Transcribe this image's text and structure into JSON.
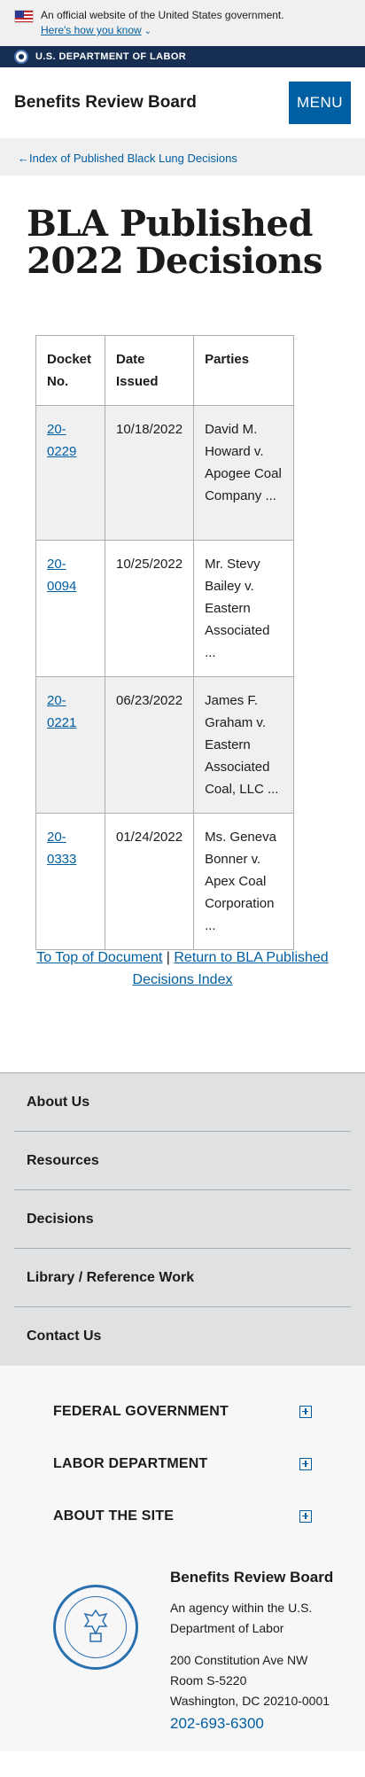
{
  "gov_banner": {
    "text": "An official website of the United States government.",
    "link": "Here's how you know"
  },
  "dol_bar": {
    "label": "U.S. DEPARTMENT OF LABOR"
  },
  "header": {
    "title": "Benefits Review Board",
    "menu_label": "MENU"
  },
  "breadcrumb": {
    "link": "Index of Published Black Lung Decisions"
  },
  "page": {
    "title": "BLA Published 2022 Decisions"
  },
  "table": {
    "headers": [
      "Docket No.",
      "Date Issued",
      "Parties"
    ],
    "rows": [
      {
        "docket": "20-0229",
        "date": "10/18/2022",
        "parties": "David M. Howard v. Apogee Coal Company ..."
      },
      {
        "docket": "20-0094",
        "date": "10/25/2022",
        "parties": "Mr. Stevy Bailey v. Eastern Associated ..."
      },
      {
        "docket": "20-0221",
        "date": "06/23/2022",
        "parties": "James F. Graham v. Eastern Associated Coal, LLC ..."
      },
      {
        "docket": "20-0333",
        "date": "01/24/2022",
        "parties": "Ms. Geneva Bonner v. Apex Coal Corporation ..."
      }
    ]
  },
  "after_links": {
    "top": "To Top of Document",
    "separator": "|",
    "return": "Return to BLA Published Decisions Index"
  },
  "footer_nav": [
    "About Us",
    "Resources",
    "Decisions",
    "Library / Reference Work",
    "Contact Us"
  ],
  "secondary_footer": [
    "FEDERAL GOVERNMENT",
    "LABOR DEPARTMENT",
    "ABOUT THE SITE"
  ],
  "agency": {
    "name": "Benefits Review Board",
    "description": "An agency within the U.S. Department of Labor",
    "address1": "200 Constitution Ave NW",
    "address2": "Room S-5220",
    "address3": "Washington, DC 20210-0001",
    "phone": "202-693-6300"
  },
  "colors": {
    "primary": "#005ea2",
    "navy": "#162e51",
    "banner_bg": "#f0f0f0",
    "footer_bg": "#dfe1e2"
  },
  "icons": {
    "flag": "us-flag-icon",
    "seal": "dol-seal-icon",
    "chevron": "chevron-down-icon",
    "plus": "plus-box-icon",
    "arrow": "arrow-left-icon"
  }
}
